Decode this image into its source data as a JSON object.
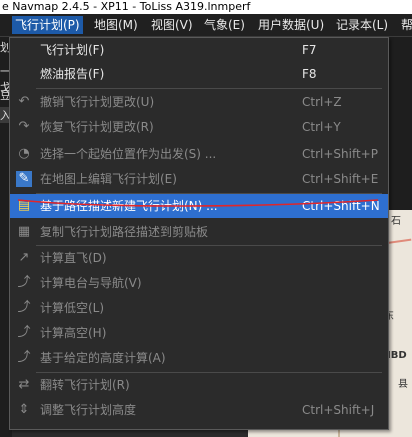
{
  "window": {
    "title": "e Navmap 2.4.5 - XP11 - ToLiss A319.lnmperf"
  },
  "menubar": [
    {
      "label": "飞行计划(P)",
      "active": true
    },
    {
      "label": "地图(M)",
      "active": false
    },
    {
      "label": "视图(V)",
      "active": false
    },
    {
      "label": "气象(E)",
      "active": false
    },
    {
      "label": "用户数据(U)",
      "active": false
    },
    {
      "label": "记录本(L)",
      "active": false
    },
    {
      "label": "帮",
      "active": false
    }
  ],
  "left_strip": [
    "划",
    "一戈",
    "豆",
    "入"
  ],
  "map": {
    "labels": [
      "石",
      "东",
      "IBD",
      "县"
    ]
  },
  "menu": {
    "items": [
      {
        "icon": "none",
        "label": "飞行计划(F)",
        "shortcut": "F7",
        "state": "normal"
      },
      {
        "icon": "none",
        "label": "燃油报告(F)",
        "shortcut": "F8",
        "state": "normal"
      },
      {
        "icon": "undo-icon",
        "label": "撤销飞行计划更改(U)",
        "shortcut": "Ctrl+Z",
        "state": "disabled"
      },
      {
        "icon": "redo-icon",
        "label": "恢复飞行计划更改(R)",
        "shortcut": "Ctrl+Y",
        "state": "disabled"
      },
      {
        "icon": "departure-icon",
        "label": "选择一个起始位置作为出发(S) ...",
        "shortcut": "Ctrl+Shift+P",
        "state": "disabled"
      },
      {
        "icon": "edit-plan-icon",
        "label": "在地图上编辑飞行计划(E)",
        "shortcut": "Ctrl+Shift+E",
        "state": "disabled"
      },
      {
        "icon": "new-plan-from-route-icon",
        "label": "基于路径描述新建飞行计划(N) ...",
        "shortcut": "Ctrl+Shift+N",
        "state": "selected"
      },
      {
        "icon": "copy-route-icon",
        "label": "复制飞行计划路径描述到剪贴板",
        "shortcut": "",
        "state": "disabled"
      },
      {
        "icon": "direct-icon",
        "label": "计算直飞(D)",
        "shortcut": "",
        "state": "disabled"
      },
      {
        "icon": "radio-nav-icon",
        "label": "计算电台与导航(V)",
        "shortcut": "",
        "state": "disabled"
      },
      {
        "icon": "low-airway-icon",
        "label": "计算低空(L)",
        "shortcut": "",
        "state": "disabled"
      },
      {
        "icon": "high-airway-icon",
        "label": "计算高空(H)",
        "shortcut": "",
        "state": "disabled"
      },
      {
        "icon": "altitude-calc-icon",
        "label": "基于给定的高度计算(A)",
        "shortcut": "",
        "state": "disabled"
      },
      {
        "icon": "reverse-icon",
        "label": "翻转飞行计划(R)",
        "shortcut": "",
        "state": "disabled"
      },
      {
        "icon": "adjust-altitude-icon",
        "label": "调整飞行计划高度",
        "shortcut": "Ctrl+Shift+J",
        "state": "disabled"
      }
    ]
  },
  "colors": {
    "selected_bg": "#2e6fd0",
    "active_menu_bg": "#1d5aa8",
    "annotation_red": "#e0262a"
  }
}
